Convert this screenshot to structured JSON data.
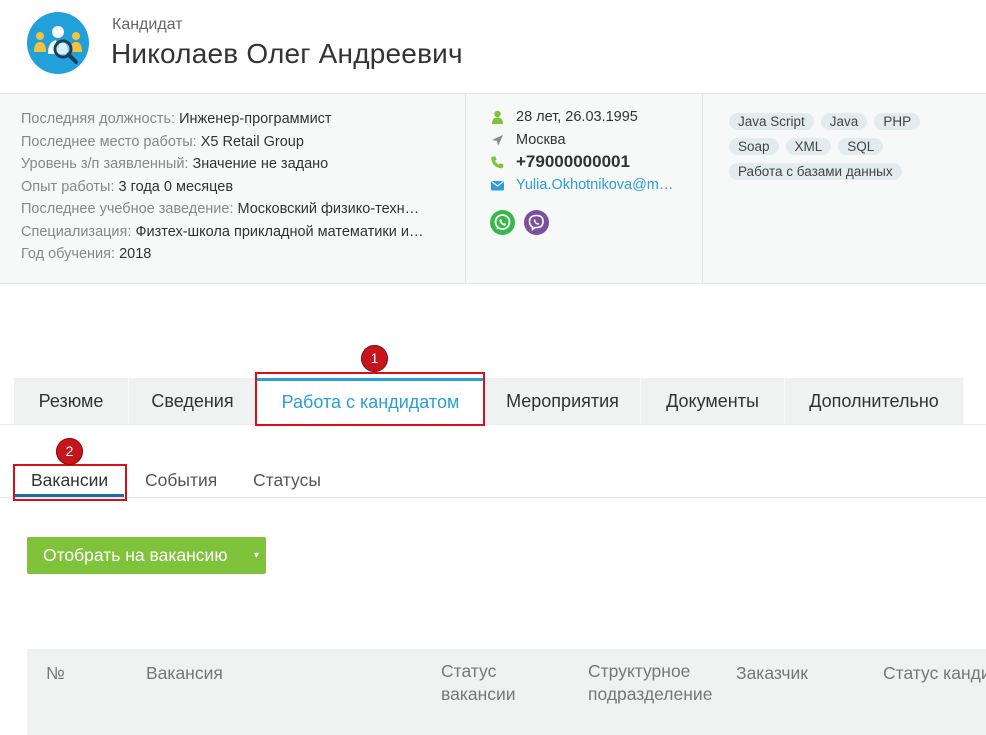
{
  "header": {
    "label": "Кандидат",
    "name": "Николаев Олег Андреевич"
  },
  "details": [
    {
      "label": "Последняя должность:",
      "value": "Инженер-программист"
    },
    {
      "label": "Последнее место работы:",
      "value": "X5 Retail Group"
    },
    {
      "label": "Уровень з/п заявленный:",
      "value": "Значение не задано"
    },
    {
      "label": "Опыт работы:",
      "value": "3 года 0 месяцев"
    },
    {
      "label": "Последнее учебное заведение:",
      "value": "Московский физико-техн…"
    },
    {
      "label": "Специализация:",
      "value": "Физтех-школа прикладной математики и…"
    },
    {
      "label": "Год обучения:",
      "value": "2018"
    }
  ],
  "contacts": {
    "age_birth": "28 лет, 26.03.1995",
    "city": "Москва",
    "phone": "+79000000001",
    "email": "Yulia.Okhotnikova@mi…",
    "messengers": [
      "whatsapp-icon",
      "viber-icon"
    ]
  },
  "skills": [
    "Java Script",
    "Java",
    "PHP",
    "Soap",
    "XML",
    "SQL",
    "Работа с базами данных"
  ],
  "tabs": [
    {
      "label": "Резюме"
    },
    {
      "label": "Сведения"
    },
    {
      "label": "Работа с кандидатом",
      "active": true
    },
    {
      "label": "Мероприятия"
    },
    {
      "label": "Документы"
    },
    {
      "label": "Дополнительно"
    }
  ],
  "subtabs": [
    {
      "label": "Вакансии",
      "active": true
    },
    {
      "label": "События"
    },
    {
      "label": "Статусы"
    }
  ],
  "actions": {
    "select_vacancy": "Отобрать на вакансию",
    "caret": "▾"
  },
  "table": {
    "columns": [
      "№",
      "Вакансия",
      "Статус вакансии",
      "Структурное подразделение",
      "Заказчик",
      "Статус канди"
    ],
    "col1": "№",
    "col2": "Вакансия",
    "col3_l1": "Статус",
    "col3_l2": "вакансии",
    "col4_l1": "Структурное",
    "col4_l2": "подразделение",
    "col5": "Заказчик",
    "col6": "Статус канди"
  },
  "annotations": {
    "badge1": "1",
    "badge2": "2"
  },
  "colors": {
    "accent": "#2a9fd6",
    "button": "#7fc33b",
    "highlight": "#d9101a",
    "person_icon": "#7fc33b",
    "email_icon": "#2a9fd6",
    "whatsapp": "#36b84b",
    "viber": "#7b4f9d"
  }
}
